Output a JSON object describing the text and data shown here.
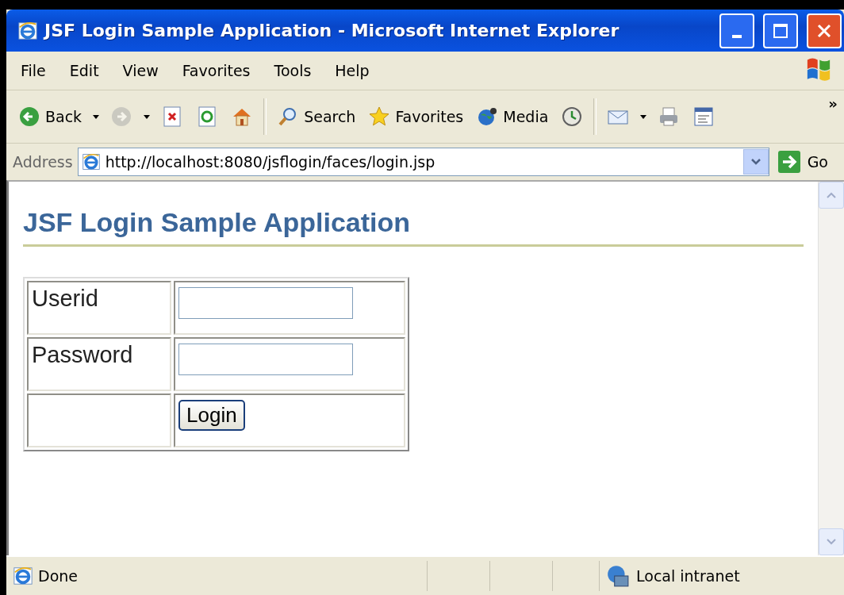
{
  "window": {
    "title": "JSF Login Sample Application - Microsoft Internet Explorer"
  },
  "menu": [
    "File",
    "Edit",
    "View",
    "Favorites",
    "Tools",
    "Help"
  ],
  "toolbar": [
    {
      "kind": "back",
      "label": "Back",
      "disabled": false,
      "dropdown": true
    },
    {
      "kind": "forward",
      "disabled": true,
      "dropdown": true
    },
    {
      "kind": "stop",
      "disabled": false,
      "dropdown": false
    },
    {
      "kind": "refresh",
      "disabled": false,
      "dropdown": false
    },
    {
      "kind": "home",
      "disabled": false,
      "dropdown": false
    },
    {
      "kind": "separator"
    },
    {
      "kind": "search",
      "label": "Search",
      "disabled": false,
      "dropdown": false
    },
    {
      "kind": "favorites",
      "label": "Favorites",
      "disabled": false,
      "dropdown": false
    },
    {
      "kind": "media",
      "label": "Media",
      "disabled": false,
      "dropdown": false
    },
    {
      "kind": "history",
      "disabled": false,
      "dropdown": false
    },
    {
      "kind": "separator"
    },
    {
      "kind": "mail",
      "disabled": false,
      "dropdown": true
    },
    {
      "kind": "print",
      "disabled": false,
      "dropdown": false
    },
    {
      "kind": "edit",
      "disabled": false,
      "dropdown": false
    }
  ],
  "toolbar_more": "»",
  "address": {
    "label": "Address",
    "value": "http://localhost:8080/jsflogin/faces/login.jsp",
    "go": "Go"
  },
  "page": {
    "heading": "JSF Login Sample Application",
    "form": [
      {
        "kind": "text",
        "label": "Userid"
      },
      {
        "kind": "password",
        "label": "Password"
      },
      {
        "kind": "button",
        "button": "Login"
      }
    ]
  },
  "status_bar": {
    "text": "Done",
    "zone": "Local intranet"
  }
}
